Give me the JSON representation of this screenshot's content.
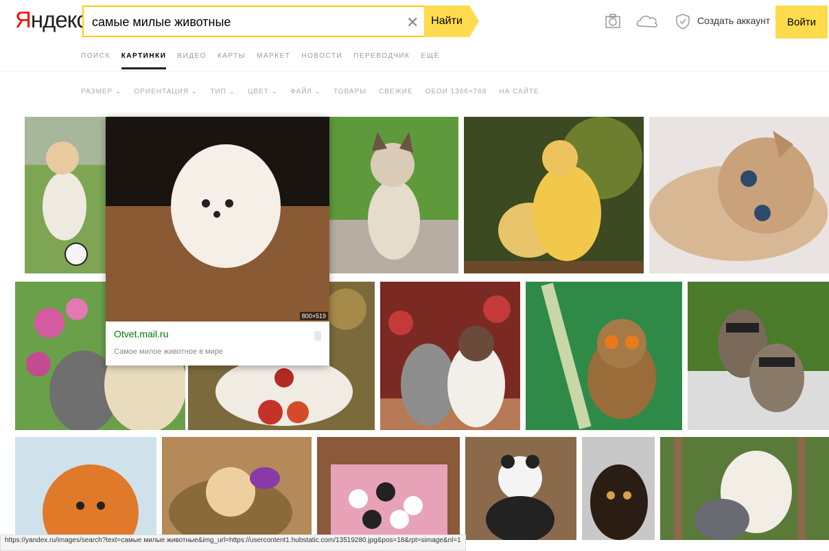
{
  "header": {
    "logo": "Яндекс",
    "search_value": "самые милые животные",
    "search_button": "Найти",
    "create_account": "Создать аккаунт",
    "login": "Войти",
    "icons": [
      "camera-icon",
      "cloud-icon",
      "shield-icon"
    ]
  },
  "tabs": [
    "ПОИСК",
    "КАРТИНКИ",
    "ВИДЕО",
    "КАРТЫ",
    "МАРКЕТ",
    "НОВОСТИ",
    "ПЕРЕВОДЧИК",
    "ЕЩЁ"
  ],
  "active_tab": "КАРТИНКИ",
  "filters": [
    "РАЗМЕР ⌄",
    "ОРИЕНТАЦИЯ ⌄",
    "ТИП ⌄",
    "ЦВЕТ ⌄",
    "ФАЙЛ ⌄",
    "ТОВАРЫ",
    "СВЕЖИЕ",
    "ОБОИ 1366×768",
    "НА САЙТЕ"
  ],
  "preview": {
    "domain": "Otvet.mail.ru",
    "description": "Самое милое животное в мире",
    "dimensions": "800×519"
  },
  "status_url": "https://yandex.ru/images/search?text=самые милые животные&img_url=https://usercontent1.hubstatic.com/13519280.jpg&pos=18&rpt=simage&nl=1",
  "colors": {
    "accent": "#ffdb4d",
    "logo_red": "#ff0000",
    "domain_green": "#007700"
  }
}
